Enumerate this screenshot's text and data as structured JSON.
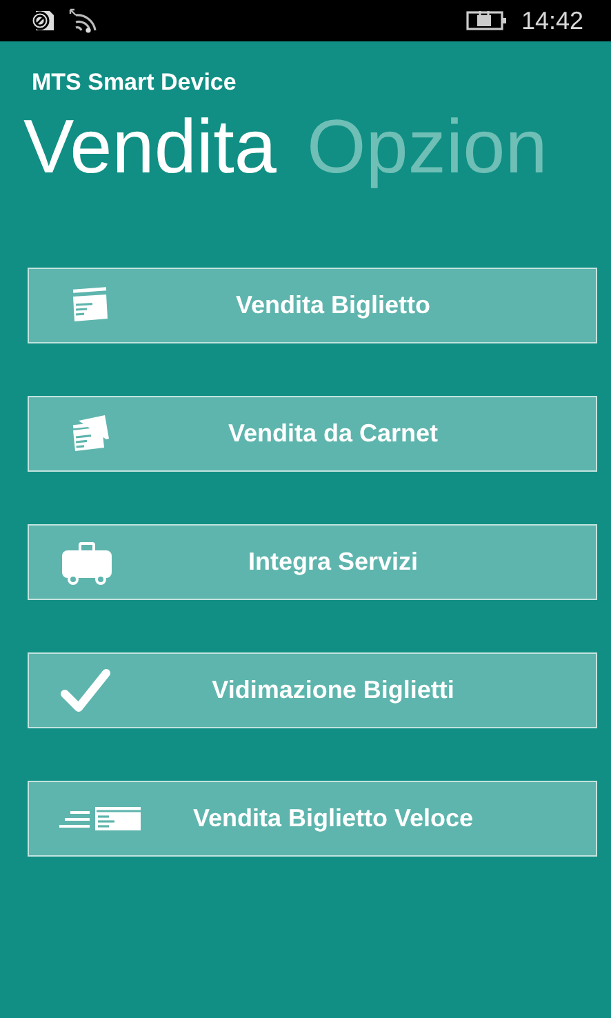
{
  "status_bar": {
    "time": "14:42"
  },
  "app_title": "MTS Smart Device",
  "pivot": [
    {
      "label": "Vendita",
      "selected": true
    },
    {
      "label": "Opzion",
      "selected": false
    }
  ],
  "buttons": [
    {
      "label": "Vendita Biglietto",
      "kind": "ticket"
    },
    {
      "label": "Vendita da Carnet",
      "kind": "tickets"
    },
    {
      "label": "Integra Servizi",
      "kind": "cart"
    },
    {
      "label": "Vidimazione Biglietti",
      "kind": "check"
    },
    {
      "label": "Vendita Biglietto Veloce",
      "kind": "fast-ticket"
    }
  ]
}
